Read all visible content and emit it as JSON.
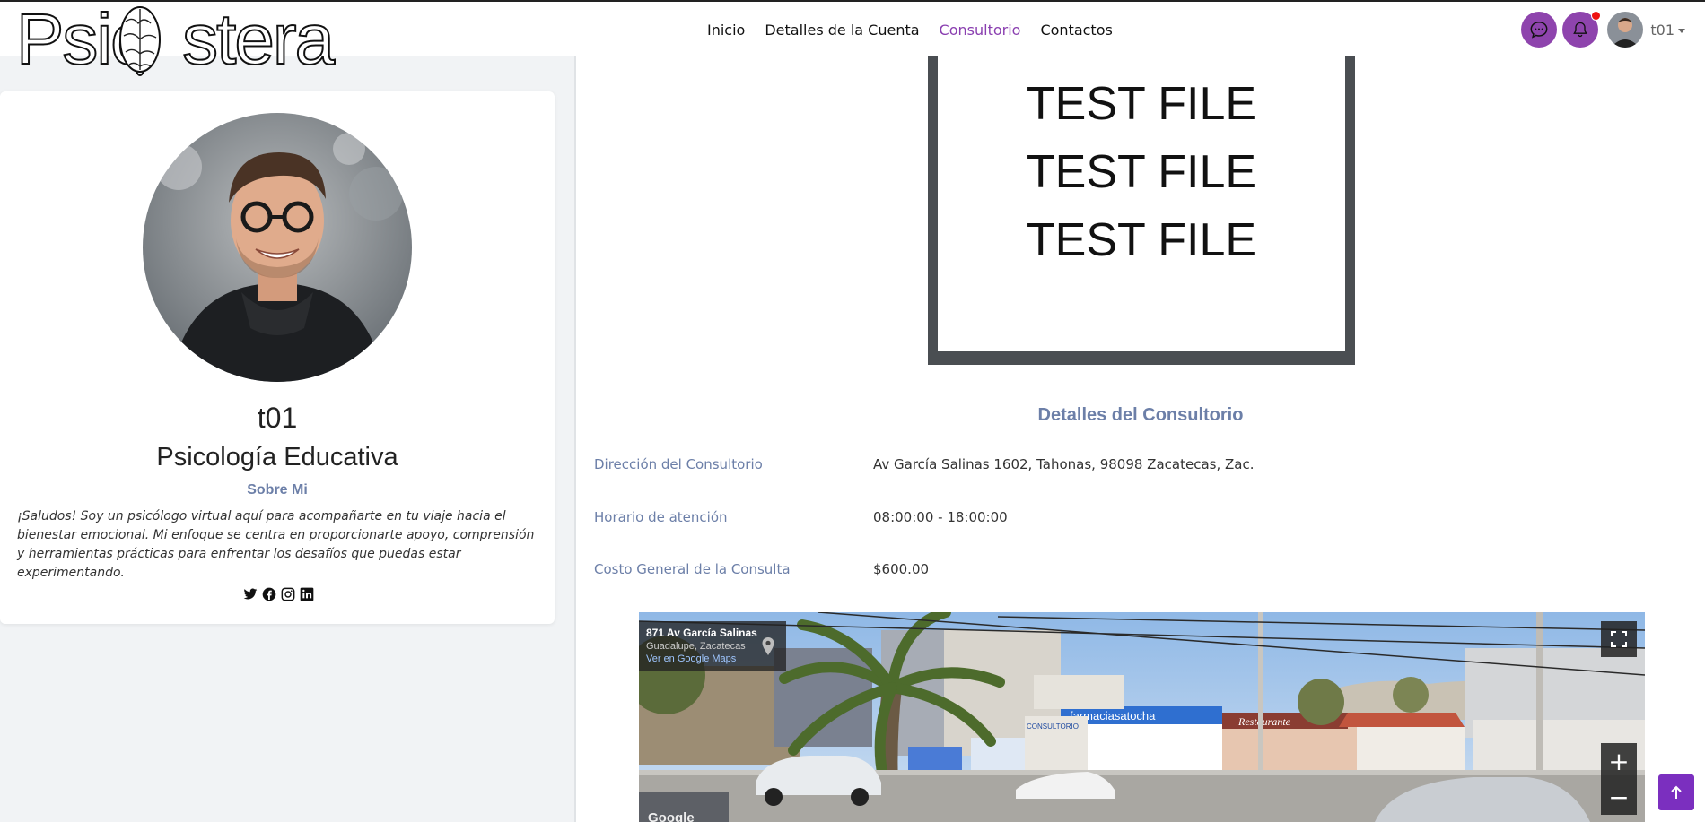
{
  "brand": {
    "name": "Psicostera",
    "left_part": "Psic",
    "right_part": "stera"
  },
  "nav": {
    "links": [
      {
        "label": "Inicio",
        "active": false
      },
      {
        "label": "Detalles de la Cuenta",
        "active": false
      },
      {
        "label": "Consultorio",
        "active": true
      },
      {
        "label": "Contactos",
        "active": false
      }
    ],
    "chat_icon": "chat-icon",
    "bell_icon": "bell-icon",
    "has_notification": true,
    "username": "t01"
  },
  "profile": {
    "name": "t01",
    "specialty": "Psicología Educativa",
    "about_title": "Sobre Mi",
    "about_text": "¡Saludos! Soy un psicólogo virtual aquí para acompañarte en tu viaje hacia el bienestar emocional. Mi enfoque se centra en proporcionarte apoyo, comprensión y herramientas prácticas para enfrentar los desafíos que puedas estar experimentando.",
    "social": [
      "twitter-icon",
      "facebook-icon",
      "instagram-icon",
      "linkedin-icon"
    ]
  },
  "document": {
    "lines": [
      "TEST FILE",
      "TEST FILE",
      "TEST FILE"
    ]
  },
  "consultorio": {
    "title": "Detalles del Consultorio",
    "details": [
      {
        "label": "Dirección del Consultorio",
        "value": "Av García Salinas 1602, Tahonas, 98098 Zacatecas, Zac."
      },
      {
        "label": "Horario de atención",
        "value": "08:00:00 - 18:00:00"
      },
      {
        "label": "Costo General de la Consulta",
        "value": "$600.00"
      }
    ]
  },
  "streetview": {
    "address": "871 Av García Salinas",
    "area": "Guadalupe, Zacatecas",
    "link": "Ver en Google Maps",
    "zoom_in": "+",
    "zoom_out": "−",
    "watermark": "Google",
    "signs": [
      "CONSULTORIO",
      "farmaciasatocha",
      "Restaurante"
    ]
  },
  "colors": {
    "accent": "#8e44ad",
    "label": "#6c7fa8",
    "active_link": "#8a3fb0"
  }
}
